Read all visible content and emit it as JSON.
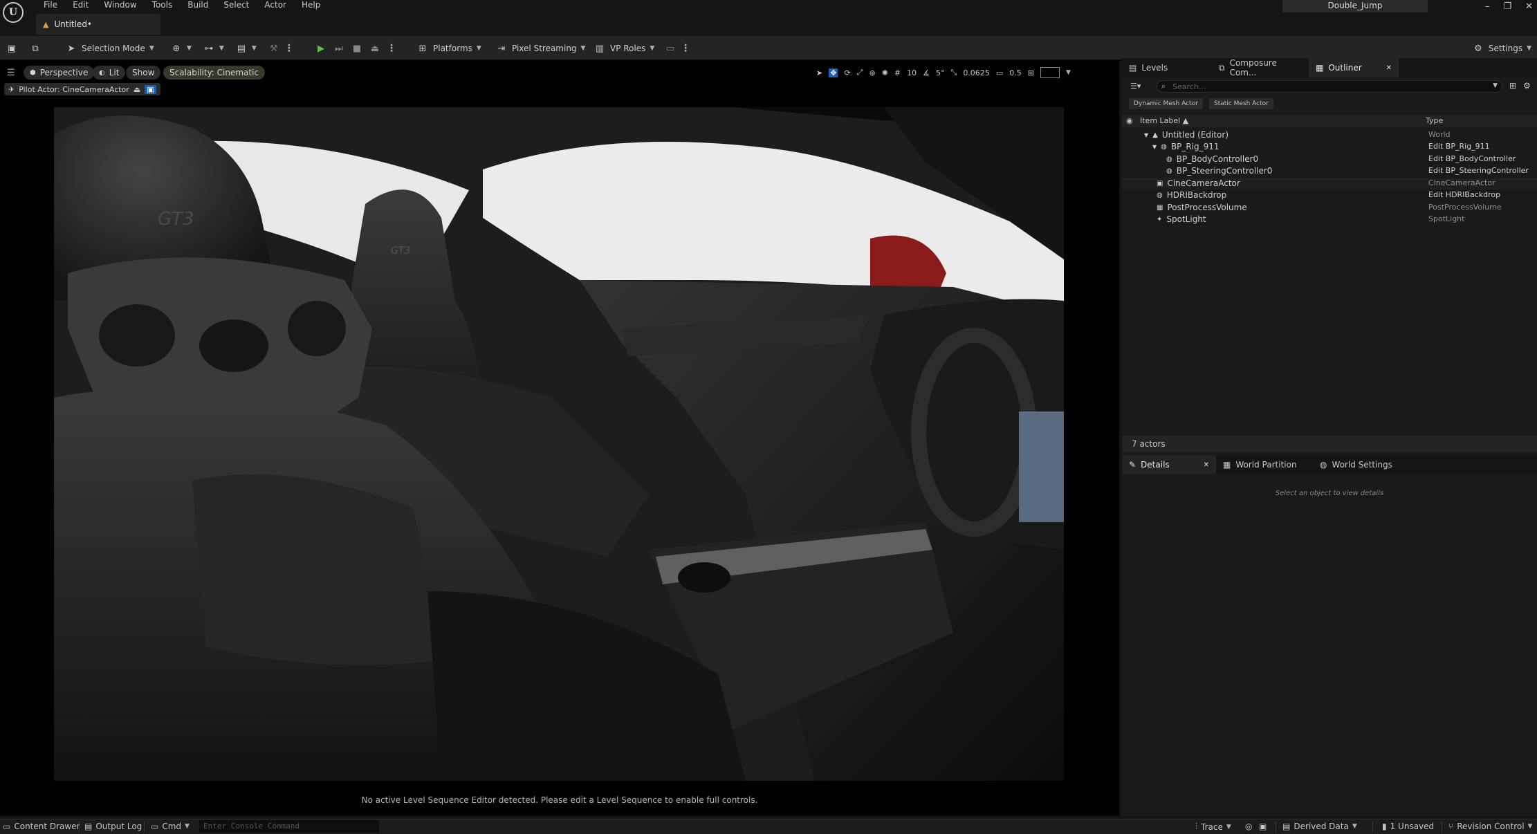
{
  "menubar": {
    "items": [
      "File",
      "Edit",
      "Window",
      "Tools",
      "Build",
      "Select",
      "Actor",
      "Help"
    ],
    "project_name": "Double_Jump",
    "tab_label": "Untitled•"
  },
  "toolbar": {
    "selection_mode": "Selection Mode",
    "platforms": "Platforms",
    "pixel_streaming": "Pixel Streaming",
    "vp_roles": "VP Roles",
    "settings": "Settings"
  },
  "viewport": {
    "perspective": "Perspective",
    "lit": "Lit",
    "show": "Show",
    "scalability": "Scalability: Cinematic",
    "pilot_actor": "Pilot Actor: CineCameraActor",
    "grid_snap": "10",
    "rotation_snap": "5°",
    "scale_snap": "0.0625",
    "camera_speed": "0.5",
    "headrest_text_1": "GT3",
    "headrest_text_2": "GT3",
    "sequence_message": "No active Level Sequence Editor detected. Please edit a Level Sequence to enable full controls."
  },
  "outliner": {
    "tabs": [
      "Levels",
      "Composure Com...",
      "Outliner"
    ],
    "search_placeholder": "Search...",
    "filters": [
      "Dynamic Mesh Actor",
      "Static Mesh Actor"
    ],
    "col_label": "Item Label ▲",
    "col_type": "Type",
    "rows": [
      {
        "label": "Untitled (Editor)",
        "type": "World"
      },
      {
        "label": "BP_Rig_911",
        "type": "Edit BP_Rig_911"
      },
      {
        "label": "BP_BodyController0",
        "type": "Edit BP_BodyController"
      },
      {
        "label": "BP_SteeringController0",
        "type": "Edit BP_SteeringController"
      },
      {
        "label": "CineCameraActor",
        "type": "CineCameraActor"
      },
      {
        "label": "HDRIBackdrop",
        "type": "Edit HDRIBackdrop"
      },
      {
        "label": "PostProcessVolume",
        "type": "PostProcessVolume"
      },
      {
        "label": "SpotLight",
        "type": "SpotLight"
      }
    ],
    "actor_count": "7 actors"
  },
  "details": {
    "tabs": [
      "Details",
      "World Partition",
      "World Settings"
    ],
    "empty_message": "Select an object to view details"
  },
  "statusbar": {
    "content_drawer": "Content Drawer",
    "output_log": "Output Log",
    "cmd": "Cmd",
    "console_placeholder": "Enter Console Command",
    "trace": "Trace",
    "derived_data": "Derived Data",
    "unsaved": "1 Unsaved",
    "revision_control": "Revision Control"
  }
}
